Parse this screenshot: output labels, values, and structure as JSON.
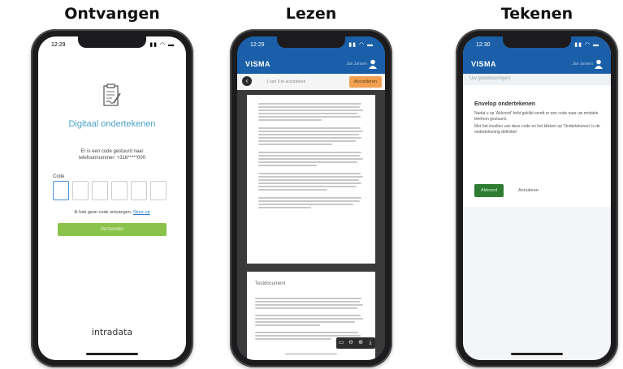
{
  "panels": [
    {
      "heading": "Ontvangen",
      "time": "12:29",
      "title": "Digitaal ondertekenen",
      "info": "Er is een code gestuurd naar telefoonnummer: +316*****000",
      "code_label": "Code",
      "no_code_text": "Ik heb geen code ontvangen.",
      "no_code_link": "Stuur op",
      "submit_label": "Verzenden",
      "logo": "intradata"
    },
    {
      "heading": "Lezen",
      "time": "12:29",
      "brand": "VISMA",
      "user": "Jan Jansen",
      "toolbar_mid": "1 van 3 te accorderen",
      "action_label": "Accorderen",
      "page2_title": "Testdocument"
    },
    {
      "heading": "Tekenen",
      "time": "12:30",
      "brand": "VISMA",
      "user": "Jan Jansen",
      "breadcrumb": "Uw goedkeuringen",
      "card_title": "Envelop ondertekenen",
      "paragraph1": "Nadat u op 'Akkoord' hebt geklikt wordt er een code naar uw mobiele telefoon gestuurd.",
      "paragraph2": "Met het invullen van deze code en het klikken op 'Ondertekenen' is de ondertekening definitief.",
      "accept_label": "Akkoord",
      "cancel_label": "Annuleren"
    }
  ],
  "colors": {
    "visma_blue": "#1b5fa8",
    "accent_green": "#8bc34a",
    "dark_green": "#2e7d32",
    "orange": "#f0a050",
    "link_blue": "#2a7bd0"
  },
  "icons": {
    "document": "document-sign-icon",
    "back": "back-arrow-icon",
    "user": "user-icon",
    "zoom_in": "zoom-in-icon",
    "zoom_out": "zoom-out-icon",
    "fit_page": "fit-page-icon",
    "download": "download-icon"
  }
}
